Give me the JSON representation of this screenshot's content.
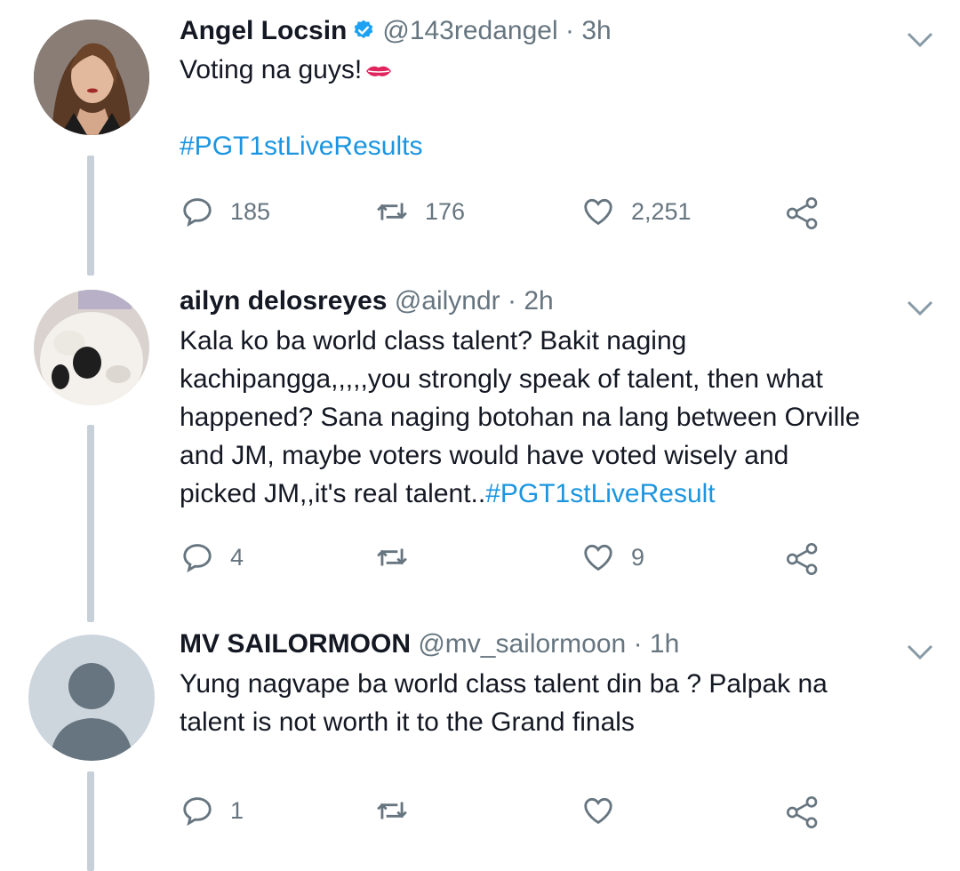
{
  "tweets": [
    {
      "name": "Angel Locsin",
      "verified": true,
      "handle": "@143redangel",
      "time": "3h",
      "text": "Voting na guys!",
      "emoji": "kiss-lips",
      "hashtag": "#PGT1stLiveResults",
      "replies": "185",
      "retweets": "176",
      "likes": "2,251"
    },
    {
      "name": "ailyn delosreyes",
      "handle": "@ailyndr",
      "time": "2h",
      "lines": [
        "Kala ko ba world class talent? Bakit naging",
        "kachipangga,,,,,you strongly speak of talent, then what",
        "happened? Sana naging botohan na lang between Orville",
        "and JM, maybe voters would have voted wisely and",
        "picked JM,,it's real talent.."
      ],
      "hashtag": "#PGT1stLiveResult",
      "replies": "4",
      "retweets": "",
      "likes": "9"
    },
    {
      "name": "MV SAILORMOON",
      "handle": "@mv_sailormoon",
      "time": "1h",
      "lines": [
        "Yung nagvape ba world class talent din ba ?  Palpak na",
        "talent is not worth it to the Grand finals"
      ],
      "replies": "1",
      "retweets": "",
      "likes": ""
    }
  ],
  "separator": "·",
  "colors": {
    "link": "#1b95e0",
    "muted": "#66757f",
    "thread": "#c7d0d8",
    "verified": "#1da1f2"
  }
}
